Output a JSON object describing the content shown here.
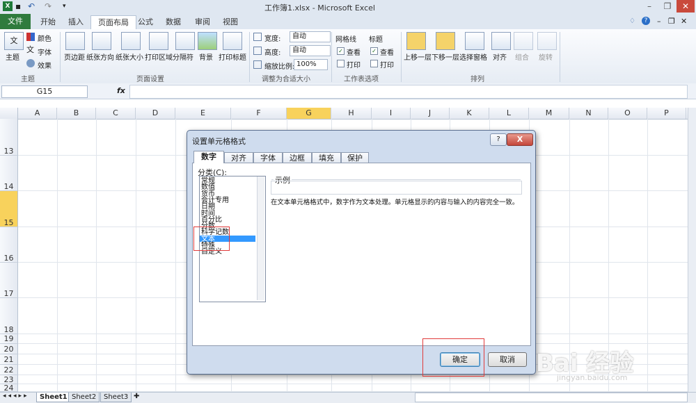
{
  "window": {
    "title": "工作簿1.xlsx - Microsoft Excel"
  },
  "tabs": [
    "文件",
    "开始",
    "插入",
    "页面布局",
    "公式",
    "数据",
    "审阅",
    "视图"
  ],
  "ribbon": {
    "theme": {
      "label": "主题",
      "colors": "颜色",
      "fonts": "字体",
      "effects": "效果",
      "group": "主题"
    },
    "page_setup": {
      "buttons": [
        "页边距",
        "纸张方向",
        "纸张大小",
        "打印区域",
        "分隔符",
        "背景",
        "打印标题"
      ],
      "group": "页面设置"
    },
    "scale": {
      "width_label": "宽度:",
      "width_value": "自动",
      "height_label": "高度:",
      "height_value": "自动",
      "zoom_label": "缩放比例:",
      "zoom_value": "100%",
      "group": "调整为合适大小"
    },
    "sheet_options": {
      "gridlines": "网格线",
      "headings": "标题",
      "view": "查看",
      "print": "打印",
      "group": "工作表选项"
    },
    "arrange": {
      "buttons": [
        "上移一层",
        "下移一层",
        "选择窗格",
        "对齐",
        "组合",
        "旋转"
      ],
      "group": "排列"
    }
  },
  "formula_bar": {
    "name_box": "G15",
    "fx": "fx"
  },
  "columns": [
    "A",
    "B",
    "C",
    "D",
    "E",
    "F",
    "G",
    "H",
    "I",
    "J",
    "K",
    "L",
    "M",
    "N",
    "O",
    "P"
  ],
  "rows": [
    "13",
    "14",
    "15",
    "16",
    "17",
    "18",
    "19",
    "20",
    "21",
    "22",
    "23",
    "24"
  ],
  "sheets": [
    "Sheet1",
    "Sheet2",
    "Sheet3"
  ],
  "dialog": {
    "title": "设置单元格格式",
    "help": "?",
    "close": "X",
    "tabs": [
      "数字",
      "对齐",
      "字体",
      "边框",
      "填充",
      "保护"
    ],
    "category_label": "分类(C):",
    "categories": [
      "常规",
      "数值",
      "货币",
      "会计专用",
      "日期",
      "时间",
      "百分比",
      "分数",
      "科学记数",
      "文本",
      "特殊",
      "自定义"
    ],
    "selected_category": "文本",
    "sample_label": "示例",
    "description": "在文本单元格格式中，数字作为文本处理。单元格显示的内容与输入的内容完全一致。",
    "ok": "确定",
    "cancel": "取消"
  },
  "watermark": {
    "text": "Bai 经验",
    "url": "jingyan.baidu.com"
  },
  "colors": {
    "file_tab": "#2f7b3d",
    "selected": "#3399ff",
    "highlight": "#e03a3a",
    "active_col": "#f8d25c"
  }
}
